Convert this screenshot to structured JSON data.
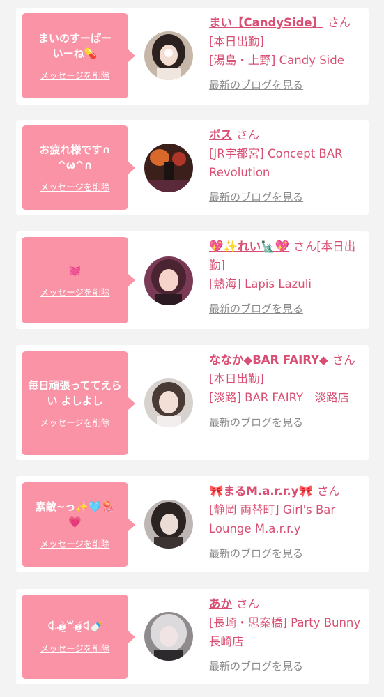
{
  "common": {
    "delete_label": "メッセージを削除",
    "honorific": "さん",
    "blog_label": "最新のブログを見る"
  },
  "colors": {
    "bubble": "#fb93a6",
    "link": "#d94f73",
    "muted": "#8a8a8a",
    "page_bg": "#f3f3f3"
  },
  "messages": [
    {
      "message": "まいのすーぱーいーね💊",
      "name": "まい【CandySide】",
      "status": "[本日出勤]",
      "shop": "[湯島・上野] Candy Side"
    },
    {
      "message": "お疲れ様です∩^ω^∩",
      "name": "ボス",
      "status": "",
      "shop": "[JR宇都宮] Concept BAR Revolution"
    },
    {
      "message": "💓",
      "name": "💖✨れい🗽💖",
      "status": "[本日出勤]",
      "shop": "[熱海] Lapis Lazuli"
    },
    {
      "message": "毎日頑張っててえらい よしよし",
      "name": "ななか◆BAR FAIRY◆",
      "status": "[本日出勤]",
      "shop": "[淡路] BAR FAIRY　淡路店"
    },
    {
      "message": "素敵~っ✨🩵🪼💗",
      "name": "🎀まるM.a.r.r.y🎀",
      "status": "",
      "shop": "[静岡 両替町] Girl's Bar Lounge M.a.r.r.y"
    },
    {
      "message": "ꒉ˶ʚ̴̶̷̤̀꒳ɞ̴̶̷̤́ꒉ🍼",
      "name": "あか",
      "status": "",
      "shop": "[長崎・思案橋] Party Bunny 長崎店"
    }
  ]
}
